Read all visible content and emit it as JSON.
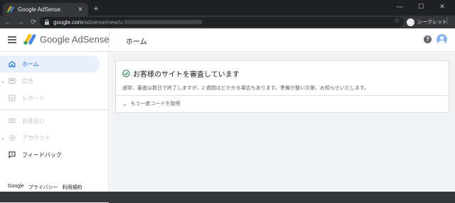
{
  "browser": {
    "tab_title": "Google AdSense",
    "tab_close": "✕",
    "new_tab": "+",
    "window": {
      "minimize": "—",
      "maximize": "☐",
      "close": "✕"
    },
    "nav": {
      "back": "←",
      "forward": "→",
      "reload": "⟳"
    },
    "url_host": "google.com",
    "url_path": "/adsense/new/u",
    "star": "☆",
    "incognito_label": "シークレット",
    "menu": "⋮"
  },
  "app": {
    "brand": "Google AdSense",
    "page_title": "ホーム",
    "help_glyph": "?",
    "colors": {
      "accent": "#1a73e8",
      "success": "#1e8e3e",
      "active_bg": "#e8f0fe"
    }
  },
  "sidebar": {
    "items": [
      {
        "label": "ホーム",
        "icon": "home-icon",
        "state": "active"
      },
      {
        "label": "広告",
        "icon": "ads-icon",
        "state": "disabled"
      },
      {
        "label": "レポート",
        "icon": "reports-icon",
        "state": "disabled"
      },
      {
        "label": "お支払い",
        "icon": "payments-icon",
        "state": "disabled"
      },
      {
        "label": "アカウント",
        "icon": "account-settings-icon",
        "state": "disabled"
      },
      {
        "label": "フィードバック",
        "icon": "feedback-icon",
        "state": "enabled"
      }
    ],
    "footer": {
      "google": "Google",
      "privacy": "プライバシー",
      "terms": "利用規約"
    }
  },
  "status_card": {
    "title": "お客様のサイトを審査しています",
    "body": "通常、審査は数日で終了しますが、2 週間ほどかかる場合もあります。準備が整い次第、お知らせいたします。",
    "expander_label": "もう一度コードを取得"
  }
}
